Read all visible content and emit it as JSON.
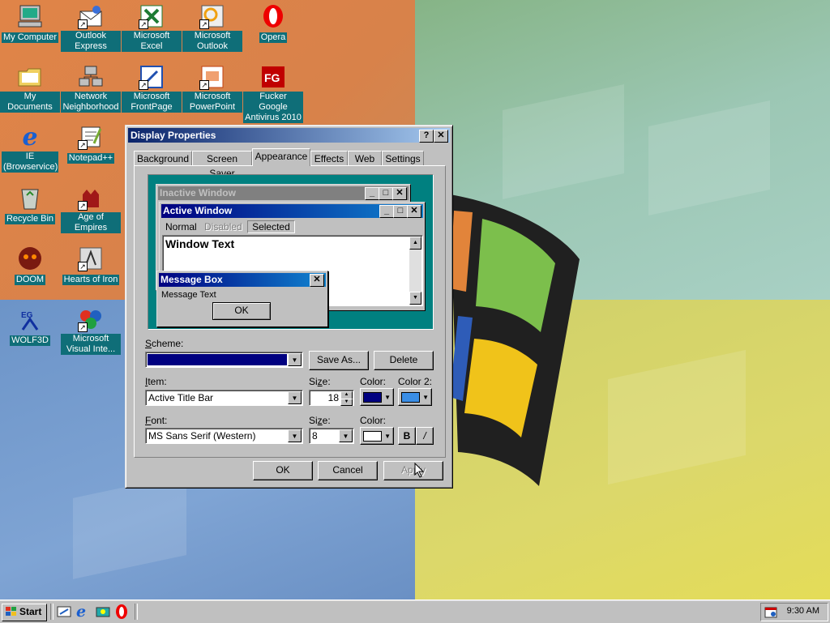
{
  "desktop": {
    "icons": [
      {
        "label": "My Computer",
        "icon": "computer-icon"
      },
      {
        "label": "Outlook Express",
        "icon": "outlook-express-icon"
      },
      {
        "label": "Microsoft Excel",
        "icon": "excel-icon"
      },
      {
        "label": "Microsoft Outlook",
        "icon": "outlook-icon"
      },
      {
        "label": "Opera",
        "icon": "opera-icon"
      },
      {
        "label": "My Documents",
        "icon": "folder-icon"
      },
      {
        "label": "Network Neighborhood",
        "icon": "network-icon"
      },
      {
        "label": "Microsoft FrontPage",
        "icon": "frontpage-icon"
      },
      {
        "label": "Microsoft PowerPoint",
        "icon": "powerpoint-icon"
      },
      {
        "label": "Fucker Google Antivirus 2010",
        "icon": "antivirus-icon"
      },
      {
        "label": "IE (Browservice)",
        "icon": "ie-icon"
      },
      {
        "label": "Notepad++",
        "icon": "notepad-icon"
      },
      {
        "label": "Recycle Bin",
        "icon": "recycle-bin-icon"
      },
      {
        "label": "Age of Empires",
        "icon": "age-of-empires-icon"
      },
      {
        "label": "DOOM",
        "icon": "doom-icon"
      },
      {
        "label": "Hearts of Iron",
        "icon": "hearts-of-iron-icon"
      },
      {
        "label": "WOLF3D",
        "icon": "wolf3d-icon"
      },
      {
        "label": "Microsoft Visual Inte...",
        "icon": "visual-interdev-icon"
      }
    ]
  },
  "dialog": {
    "title": "Display Properties",
    "help_glyph": "?",
    "close_glyph": "✕",
    "tabs": [
      "Background",
      "Screen Saver",
      "Appearance",
      "Effects",
      "Web",
      "Settings"
    ],
    "active_tab": "Appearance",
    "preview": {
      "inactive_title": "Inactive Window",
      "active_title": "Active Window",
      "menu_normal": "Normal",
      "menu_disabled": "Disabled",
      "menu_selected": "Selected",
      "window_text": "Window Text",
      "msgbox_title": "Message Box",
      "msgbox_text": "Message Text",
      "msgbox_ok": "OK"
    },
    "scheme_label_u": "S",
    "scheme_label_rest": "cheme:",
    "scheme_value": "",
    "save_as": "Save As...",
    "delete": "Delete",
    "item_label_u": "I",
    "item_label_rest": "tem:",
    "item_value": "Active Title Bar",
    "item_size_label_u": "z",
    "item_size_label": "Si|e:",
    "item_size_value": "18",
    "color_label": "Color:",
    "color2_label": "Color 2:",
    "font_label_u": "F",
    "font_label_rest": "ont:",
    "font_value": "MS Sans Serif (Western)",
    "font_size_label": "Size:",
    "font_size_value": "8",
    "font_color_label": "Color:",
    "bold_label": "B",
    "italic_label": "/",
    "ok": "OK",
    "cancel": "Cancel",
    "apply": "Apply",
    "colors": {
      "item_color": "#000080",
      "item_color2": "#3a8ee6",
      "font_color": "#ffffff",
      "scheme_fill": "#000080"
    }
  },
  "taskbar": {
    "start_label": "Start",
    "quicklaunch": [
      "show-desktop-icon",
      "ie-icon",
      "channels-icon",
      "opera-icon"
    ],
    "clock": "9:30 AM"
  }
}
